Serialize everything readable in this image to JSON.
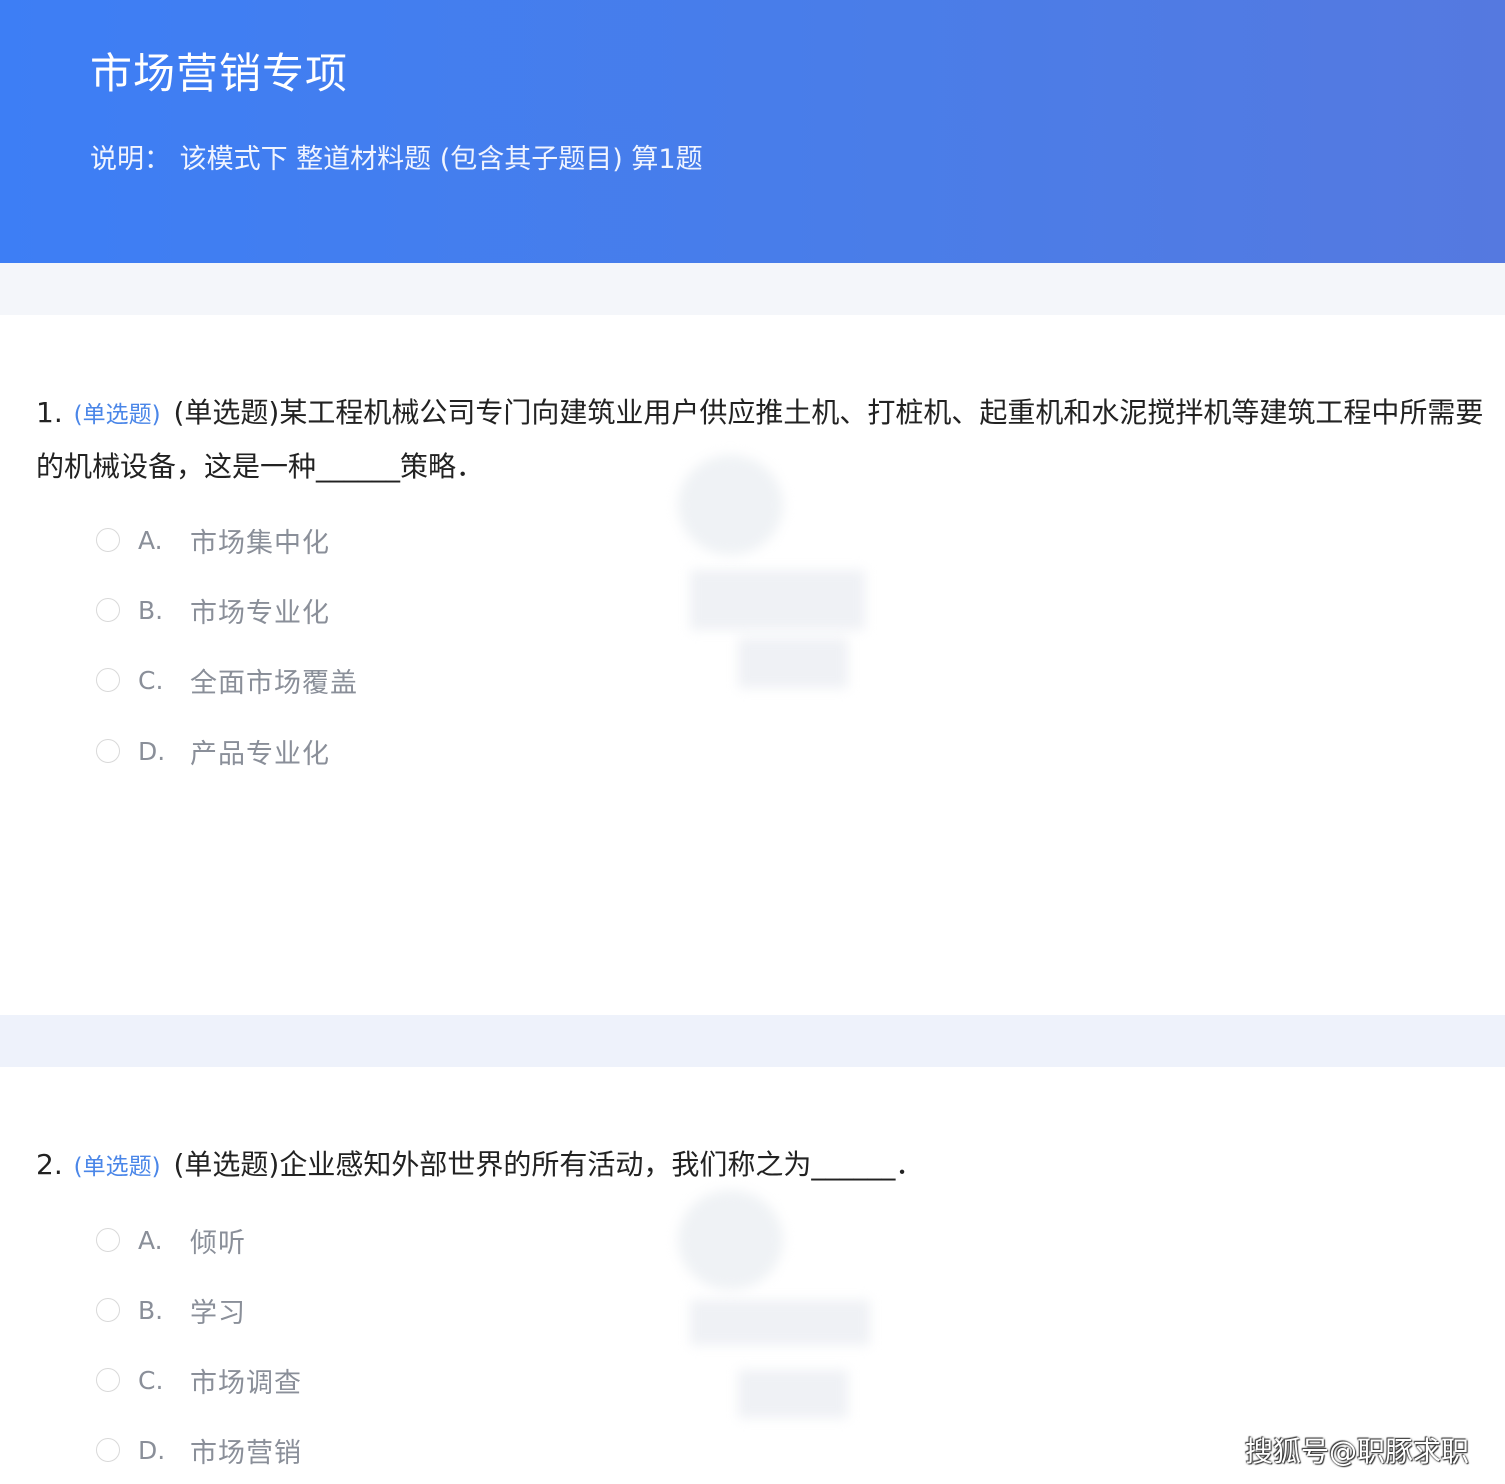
{
  "header": {
    "title": "市场营销专项",
    "description": "说明： 该模式下 整道材料题 (包含其子题目) 算1题"
  },
  "questions": [
    {
      "number": "1.",
      "type_tag": "(单选题)",
      "text": "(单选题)某工程机械公司专门向建筑业用户供应推土机、打桩机、起重机和水泥搅拌机等建筑工程中所需要的机械设备，这是一种______策略．",
      "options": [
        {
          "letter": "A.",
          "text": "市场集中化"
        },
        {
          "letter": "B.",
          "text": "市场专业化"
        },
        {
          "letter": "C.",
          "text": "全面市场覆盖"
        },
        {
          "letter": "D.",
          "text": "产品专业化"
        }
      ]
    },
    {
      "number": "2.",
      "type_tag": "(单选题)",
      "text": "(单选题)企业感知外部世界的所有活动，我们称之为______．",
      "options": [
        {
          "letter": "A.",
          "text": "倾听"
        },
        {
          "letter": "B.",
          "text": "学习"
        },
        {
          "letter": "C.",
          "text": "市场调查"
        },
        {
          "letter": "D.",
          "text": "市场营销"
        }
      ]
    }
  ],
  "footer_watermark": "搜狐号@职豚求职",
  "colors": {
    "header_bg": "#3d7ef5",
    "type_tag": "#4a86e8",
    "option_text": "#8a8f99",
    "band_bg": "#f4f6fa"
  }
}
